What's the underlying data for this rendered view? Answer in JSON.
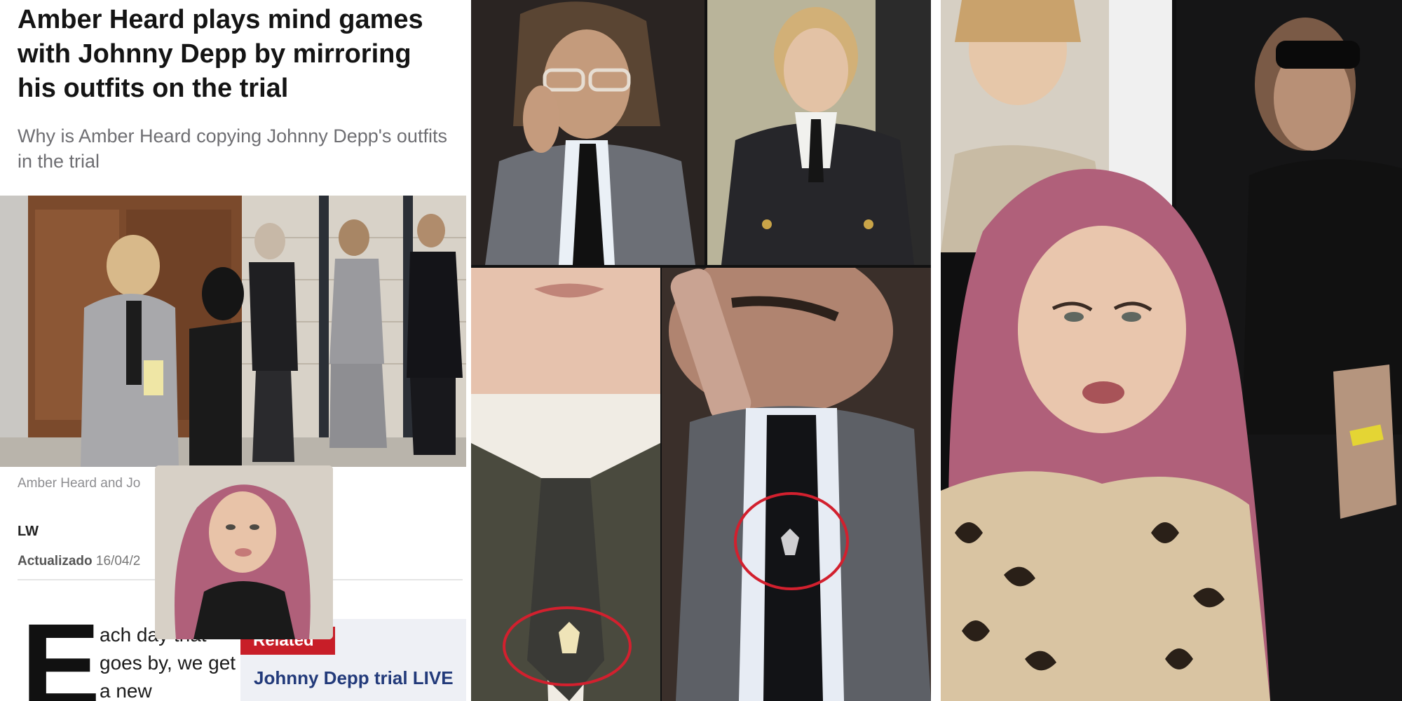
{
  "article": {
    "title": "Amber Heard plays mind games with Johnny Depp by mirroring his outfits on the trial",
    "subtitle": "Why is Amber Heard copying Johnny Depp's outfits in the trial",
    "caption": "Amber Heard and Jo",
    "author": "LW",
    "updated_label": "Actualizado",
    "updated_date": "16/04/2",
    "dropcap": "E",
    "body_start": "ach day that goes by, we get a new",
    "related_label": "Related",
    "related_link": "Johnny Depp trial LIVE"
  },
  "icons": {
    "bee-brooch": "bee-icon",
    "highlight-circle": "red-circle-annotation"
  },
  "colors": {
    "related_red": "#c81e28",
    "link_blue": "#223a7a",
    "circle_red": "#d2202e",
    "hair_pink": "#b0607a"
  }
}
